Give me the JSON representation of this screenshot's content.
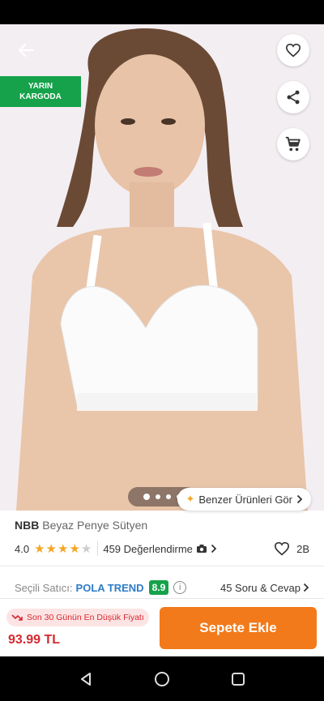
{
  "product": {
    "badge_line1": "YARIN",
    "badge_line2": "KARGODA",
    "brand": "NBB",
    "name": "Beyaz Penye Sütyen",
    "rating": "4.0",
    "stars_filled": 4,
    "stars_total": 5,
    "reviews": "459 Değerlendirme",
    "fav_count": "2B",
    "image_count": 4,
    "active_image": 1
  },
  "actions": {
    "similar_label": "Benzer Ürünleri Gör"
  },
  "seller": {
    "label": "Seçili Satıcı:",
    "name": "POLA TREND",
    "score": "8.9",
    "qa": "45 Soru & Cevap"
  },
  "purchase": {
    "price_note": "Son 30 Günün En Düşük Fiyatı",
    "price": "93.99 TL",
    "add_to_cart": "Sepete Ekle"
  },
  "colors": {
    "accent": "#f27a1a",
    "badge_green": "#15a24a",
    "price_red": "#d7282f",
    "seller_blue": "#2c7cc9",
    "star": "#f5a623"
  },
  "icons": [
    "arrow-left-icon",
    "heart-icon",
    "share-icon",
    "cart-icon",
    "sparkle-icon",
    "camera-icon",
    "chevron-right-icon",
    "info-icon",
    "trend-down-icon",
    "nav-back-icon",
    "nav-home-icon",
    "nav-recents-icon"
  ]
}
